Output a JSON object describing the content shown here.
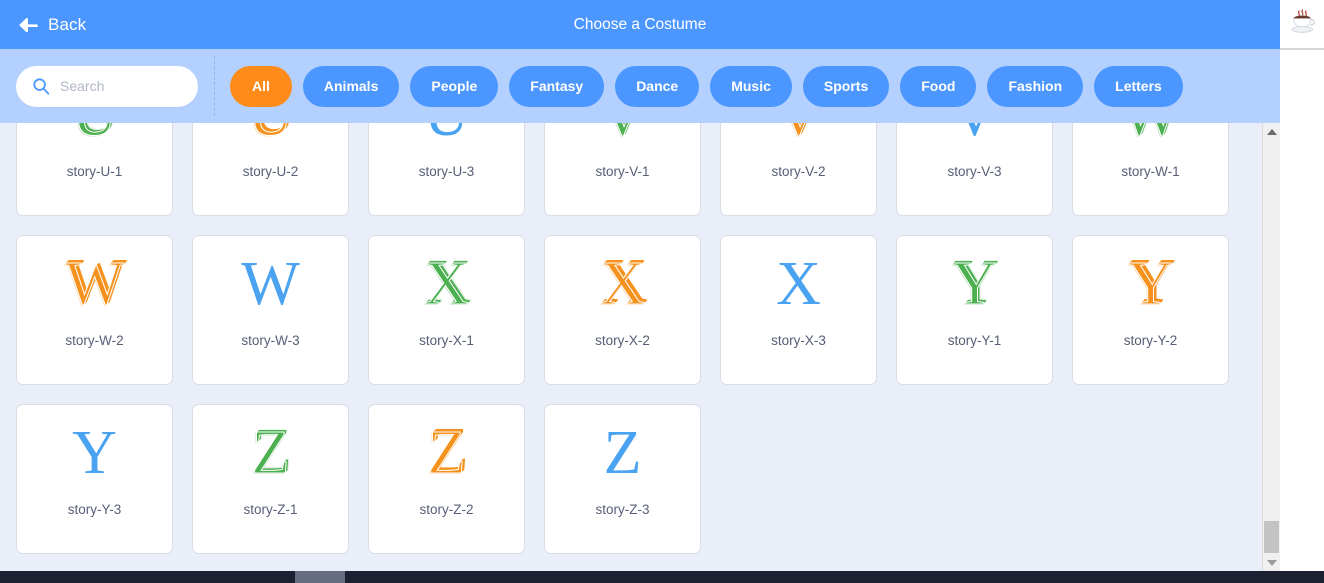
{
  "header": {
    "back_label": "Back",
    "back_icon": "arrow-left-icon",
    "title": "Choose a Costume",
    "bg_color": "#4c97ff"
  },
  "filter_bar": {
    "bg_color": "#b3d0fe",
    "search": {
      "icon": "search-icon",
      "placeholder": "Search",
      "value": ""
    },
    "categories": [
      {
        "label": "All",
        "active": true
      },
      {
        "label": "Animals",
        "active": false
      },
      {
        "label": "People",
        "active": false
      },
      {
        "label": "Fantasy",
        "active": false
      },
      {
        "label": "Dance",
        "active": false
      },
      {
        "label": "Music",
        "active": false
      },
      {
        "label": "Sports",
        "active": false
      },
      {
        "label": "Food",
        "active": false
      },
      {
        "label": "Fashion",
        "active": false
      },
      {
        "label": "Letters",
        "active": false
      }
    ],
    "active_chip_color": "#ff8c1a",
    "chip_color": "#4c97ff"
  },
  "grid": {
    "bg_color": "#e9eef8",
    "items": [
      {
        "label": "story-U-1",
        "glyph": "U",
        "variant": "v1"
      },
      {
        "label": "story-U-2",
        "glyph": "U",
        "variant": "v2"
      },
      {
        "label": "story-U-3",
        "glyph": "U",
        "variant": "v3"
      },
      {
        "label": "story-V-1",
        "glyph": "V",
        "variant": "v1"
      },
      {
        "label": "story-V-2",
        "glyph": "V",
        "variant": "v2"
      },
      {
        "label": "story-V-3",
        "glyph": "V",
        "variant": "v3"
      },
      {
        "label": "story-W-1",
        "glyph": "W",
        "variant": "v1"
      },
      {
        "label": "story-W-2",
        "glyph": "W",
        "variant": "v2"
      },
      {
        "label": "story-W-3",
        "glyph": "W",
        "variant": "v3"
      },
      {
        "label": "story-X-1",
        "glyph": "X",
        "variant": "v1"
      },
      {
        "label": "story-X-2",
        "glyph": "X",
        "variant": "v2"
      },
      {
        "label": "story-X-3",
        "glyph": "X",
        "variant": "v3"
      },
      {
        "label": "story-Y-1",
        "glyph": "Y",
        "variant": "v1"
      },
      {
        "label": "story-Y-2",
        "glyph": "Y",
        "variant": "v2"
      },
      {
        "label": "story-Y-3",
        "glyph": "Y",
        "variant": "v3"
      },
      {
        "label": "story-Z-1",
        "glyph": "Z",
        "variant": "v1"
      },
      {
        "label": "story-Z-2",
        "glyph": "Z",
        "variant": "v2"
      },
      {
        "label": "story-Z-3",
        "glyph": "Z",
        "variant": "v3"
      }
    ],
    "letter_colors": {
      "v1": "#4caf50",
      "v2": "#f5921e",
      "v3": "#4aa3f0"
    }
  },
  "scrollbars": {
    "vertical": {
      "up_icon": "caret-up-icon",
      "down_icon": "caret-down-icon"
    },
    "horizontal": {
      "thumb_color": "#666d80",
      "track_color": "#1b2033"
    }
  },
  "right_rail": {
    "icon": "java-coffee-cup-icon"
  }
}
